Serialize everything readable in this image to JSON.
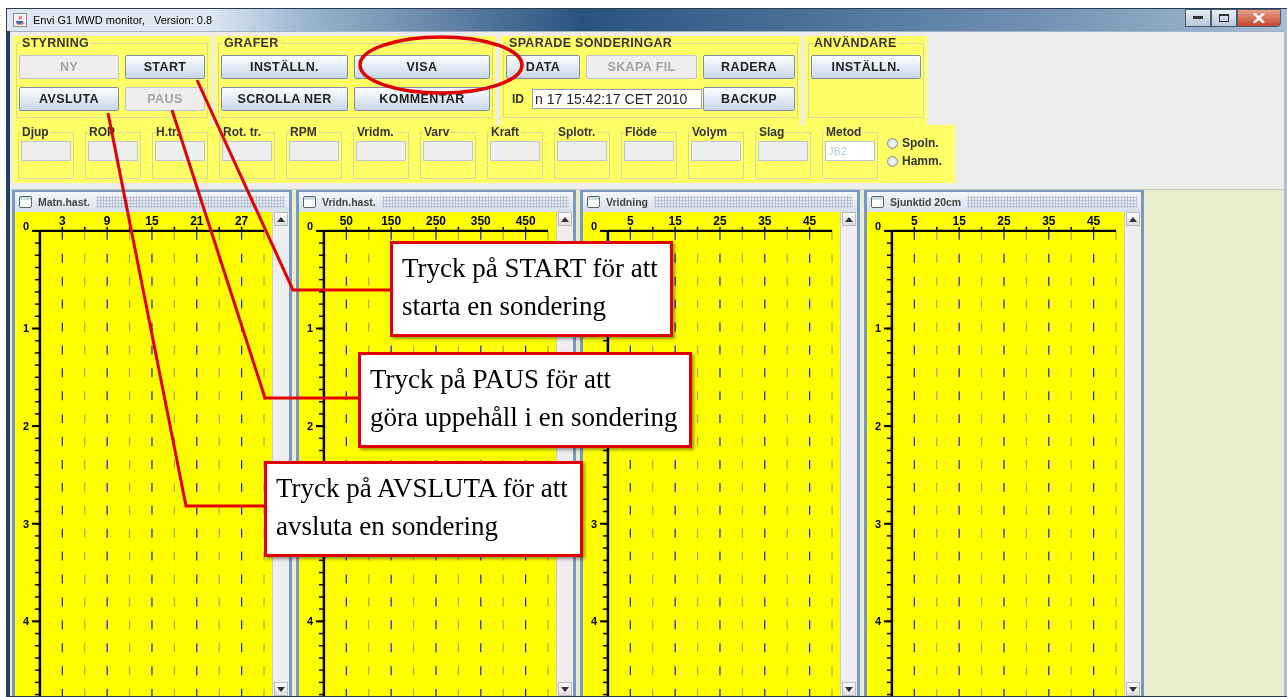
{
  "window": {
    "title": "Envi G1 MWD monitor,   Version: 0.8"
  },
  "control_groups": [
    {
      "title": "STYRNING",
      "items": [
        {
          "kind": "button",
          "label": "NY",
          "disabled": true
        },
        {
          "kind": "button",
          "label": "START",
          "disabled": false
        },
        {
          "kind": "button",
          "label": "AVSLUTA",
          "disabled": false
        },
        {
          "kind": "button",
          "label": "PAUS",
          "disabled": true
        }
      ]
    },
    {
      "title": "GRAFER",
      "items": [
        {
          "kind": "button",
          "label": "INSTÄLLN.",
          "disabled": false
        },
        {
          "kind": "button",
          "label": "VISA",
          "disabled": false
        },
        {
          "kind": "button",
          "label": "SCROLLA NER",
          "disabled": false
        },
        {
          "kind": "button",
          "label": "KOMMENTAR",
          "disabled": false
        }
      ]
    },
    {
      "title": "SPARADE SONDERINGAR",
      "items": [
        {
          "kind": "button",
          "label": "DATA",
          "disabled": false
        },
        {
          "kind": "button",
          "label": "SKAPA FIL",
          "disabled": true
        },
        {
          "kind": "button",
          "label": "RADERA",
          "disabled": false
        },
        {
          "kind": "field",
          "label": "ID",
          "value": "n 17 15:42:17 CET 2010"
        },
        {
          "kind": "button",
          "label": "BACKUP",
          "disabled": false
        }
      ]
    },
    {
      "title": "ANVÄNDARE",
      "items": [
        {
          "kind": "button",
          "label": "INSTÄLLN.",
          "disabled": false
        }
      ]
    }
  ],
  "readings": [
    {
      "label": "Djup"
    },
    {
      "label": "ROP"
    },
    {
      "label": "H.tr."
    },
    {
      "label": "Rot. tr."
    },
    {
      "label": "RPM"
    },
    {
      "label": "Vridm."
    },
    {
      "label": "Varv"
    },
    {
      "label": "Kraft"
    },
    {
      "label": "Splotr."
    },
    {
      "label": "Flöde"
    },
    {
      "label": "Volym"
    },
    {
      "label": "Slag"
    },
    {
      "label": "Metod",
      "value": "JB2",
      "disabled": true
    }
  ],
  "method_options": [
    {
      "label": "Spoln.",
      "selected": false
    },
    {
      "label": "Hamm.",
      "selected": false
    }
  ],
  "graph_frames": [
    {
      "title": "Matn.hast.",
      "x_labels": [
        "3",
        "9",
        "15",
        "21",
        "27"
      ],
      "y_ticks": [
        {
          "kind": "labeled",
          "label": "0"
        },
        {
          "kind": "labeled",
          "label": "1"
        },
        {
          "kind": "labeled",
          "label": "2"
        },
        {
          "kind": "labeled",
          "label": "3"
        },
        {
          "kind": "labeled",
          "label": "4"
        }
      ]
    },
    {
      "title": "Vridn.hast.",
      "x_labels": [
        "50",
        "150",
        "250",
        "350",
        "450"
      ],
      "y_ticks": [
        {
          "kind": "labeled",
          "label": "0"
        },
        {
          "kind": "labeled",
          "label": "1"
        },
        {
          "kind": "labeled",
          "label": "2"
        },
        {
          "kind": "plain"
        },
        {
          "kind": "labeled",
          "label": "4"
        }
      ]
    },
    {
      "title": "Vridning",
      "x_labels": [
        "5",
        "15",
        "25",
        "35",
        "45"
      ],
      "y_ticks": [
        {
          "kind": "labeled",
          "label": "0"
        },
        {
          "kind": "plain"
        },
        {
          "kind": "plain"
        },
        {
          "kind": "labeled",
          "label": "3"
        },
        {
          "kind": "labeled",
          "label": "4"
        }
      ]
    },
    {
      "title": "Sjunktid 20cm",
      "x_labels": [
        "5",
        "15",
        "25",
        "35",
        "45"
      ],
      "y_ticks": [
        {
          "kind": "labeled",
          "label": "0"
        },
        {
          "kind": "labeled",
          "label": "1"
        },
        {
          "kind": "labeled",
          "label": "2"
        },
        {
          "kind": "labeled",
          "label": "3"
        },
        {
          "kind": "labeled",
          "label": "4"
        }
      ]
    }
  ],
  "callouts": [
    {
      "lines": [
        "Tryck på START för att",
        "starta en sondering"
      ]
    },
    {
      "lines": [
        "Tryck på PAUS för att",
        "göra uppehåll i en sondering"
      ]
    },
    {
      "lines": [
        "Tryck på AVSLUTA för att",
        "avsluta en sondering"
      ]
    }
  ]
}
